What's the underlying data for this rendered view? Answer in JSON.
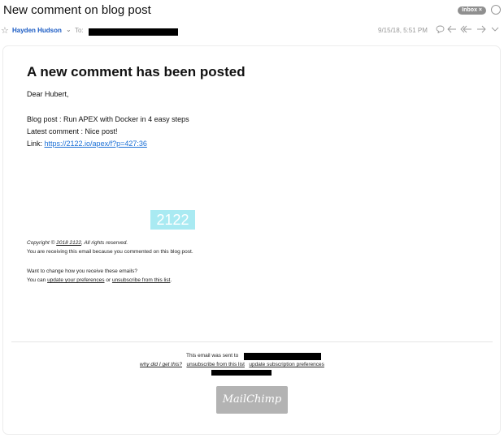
{
  "email": {
    "subject": "New comment on blog post",
    "inbox_badge": "Inbox ×",
    "sender": "Hayden Hudson",
    "to_label": "To:",
    "date": "9/15/18, 5:51 PM"
  },
  "icons": [
    "star-icon",
    "chevron-down-icon",
    "speech-bubble-icon",
    "reply-icon",
    "reply-all-icon",
    "forward-icon",
    "more-chevron-icon"
  ],
  "body": {
    "heading": "A new comment has been posted",
    "greeting": "Dear  Hubert,",
    "blog_post": "Blog post : Run APEX with Docker in 4 easy steps",
    "latest_comment": "Latest comment : Nice post!",
    "link_label": "Link: ",
    "link_url": "https://2122.io/apex/f?p=427:36",
    "logo_text": "2122"
  },
  "footer": {
    "copyright_pre": "Copyright © ",
    "copyright_link": "2018 2122",
    "copyright_post": ", All rights reserved.",
    "receiving": "You are receiving this email because you commented on this blog post.",
    "want_change": "Want to change how you receive these emails?",
    "can_pre": "You can ",
    "update_prefs": "update your preferences",
    "or": " or ",
    "unsubscribe": "unsubscribe from this list",
    "period": "."
  },
  "bottom": {
    "sent_to": "This email was sent to",
    "why": "why did I get this?",
    "unsubscribe": "unsubscribe from this list",
    "update_sub": "update subscription preferences",
    "mailchimp": "MailChimp"
  }
}
